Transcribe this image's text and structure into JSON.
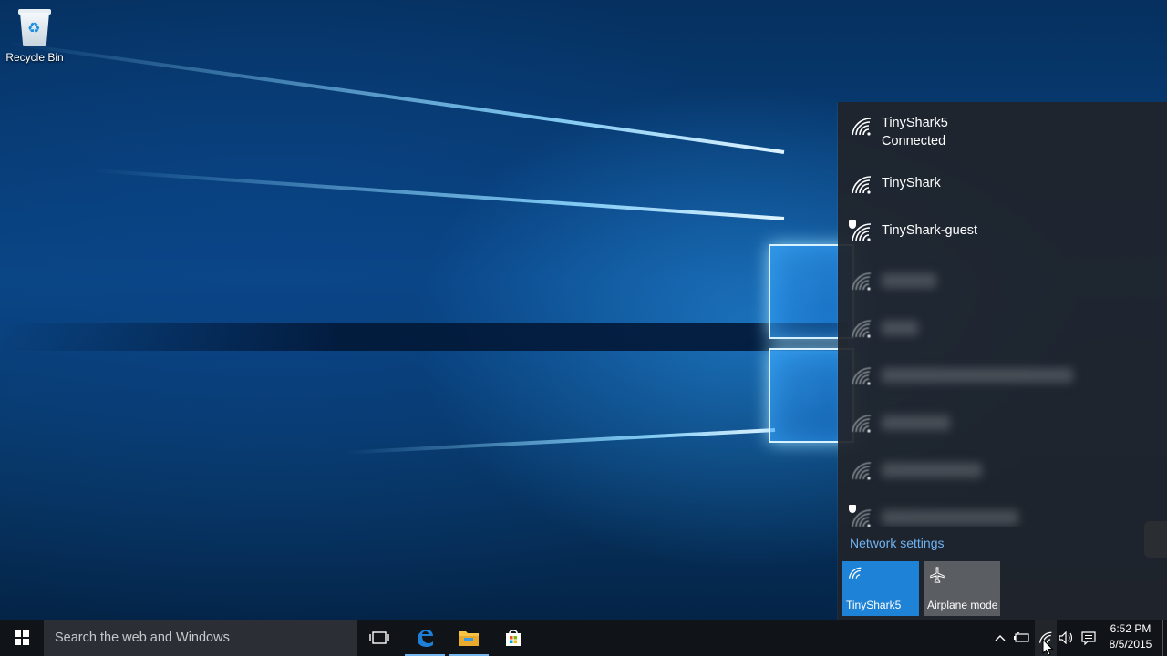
{
  "desktop": {
    "icons": [
      {
        "label": "Recycle Bin",
        "icon": "recycle-bin-icon"
      }
    ]
  },
  "network_flyout": {
    "networks": [
      {
        "name": "TinyShark5",
        "status": "Connected",
        "secured": false
      },
      {
        "name": "TinyShark",
        "status": "",
        "secured": false
      },
      {
        "name": "TinyShark-guest",
        "status": "",
        "secured": true
      }
    ],
    "settings_link": "Network settings",
    "quick_actions": [
      {
        "label": "TinyShark5",
        "icon": "wifi-icon",
        "active": true
      },
      {
        "label": "Airplane mode",
        "icon": "airplane-icon",
        "active": false
      }
    ]
  },
  "taskbar": {
    "search_placeholder": "Search the web and Windows",
    "pinned": [
      "task-view-icon",
      "edge-icon",
      "file-explorer-icon",
      "store-icon"
    ],
    "tray_icons": [
      "chevron-up-icon",
      "battery-icon",
      "wifi-icon",
      "volume-icon",
      "action-center-icon"
    ],
    "time": "6:52 PM",
    "date": "8/5/2015"
  },
  "colors": {
    "accent": "#1e83d6",
    "link": "#6fb3f2",
    "flyout_bg": "#202428",
    "taskbar_bg": "#101418"
  }
}
